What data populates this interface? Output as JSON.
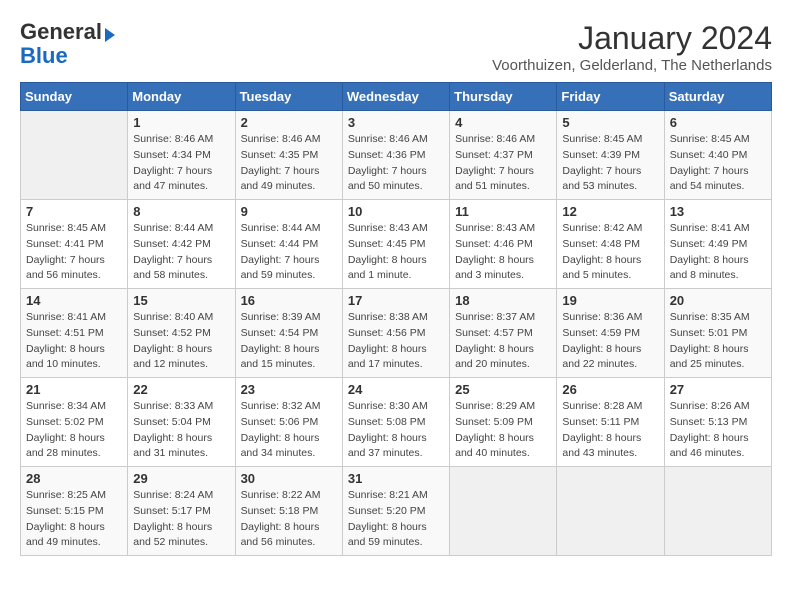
{
  "logo": {
    "general": "General",
    "blue": "Blue"
  },
  "title": "January 2024",
  "subtitle": "Voorthuizen, Gelderland, The Netherlands",
  "weekdays": [
    "Sunday",
    "Monday",
    "Tuesday",
    "Wednesday",
    "Thursday",
    "Friday",
    "Saturday"
  ],
  "weeks": [
    [
      {
        "day": "",
        "sunrise": "",
        "sunset": "",
        "daylight": ""
      },
      {
        "day": "1",
        "sunrise": "Sunrise: 8:46 AM",
        "sunset": "Sunset: 4:34 PM",
        "daylight": "Daylight: 7 hours and 47 minutes."
      },
      {
        "day": "2",
        "sunrise": "Sunrise: 8:46 AM",
        "sunset": "Sunset: 4:35 PM",
        "daylight": "Daylight: 7 hours and 49 minutes."
      },
      {
        "day": "3",
        "sunrise": "Sunrise: 8:46 AM",
        "sunset": "Sunset: 4:36 PM",
        "daylight": "Daylight: 7 hours and 50 minutes."
      },
      {
        "day": "4",
        "sunrise": "Sunrise: 8:46 AM",
        "sunset": "Sunset: 4:37 PM",
        "daylight": "Daylight: 7 hours and 51 minutes."
      },
      {
        "day": "5",
        "sunrise": "Sunrise: 8:45 AM",
        "sunset": "Sunset: 4:39 PM",
        "daylight": "Daylight: 7 hours and 53 minutes."
      },
      {
        "day": "6",
        "sunrise": "Sunrise: 8:45 AM",
        "sunset": "Sunset: 4:40 PM",
        "daylight": "Daylight: 7 hours and 54 minutes."
      }
    ],
    [
      {
        "day": "7",
        "sunrise": "Sunrise: 8:45 AM",
        "sunset": "Sunset: 4:41 PM",
        "daylight": "Daylight: 7 hours and 56 minutes."
      },
      {
        "day": "8",
        "sunrise": "Sunrise: 8:44 AM",
        "sunset": "Sunset: 4:42 PM",
        "daylight": "Daylight: 7 hours and 58 minutes."
      },
      {
        "day": "9",
        "sunrise": "Sunrise: 8:44 AM",
        "sunset": "Sunset: 4:44 PM",
        "daylight": "Daylight: 7 hours and 59 minutes."
      },
      {
        "day": "10",
        "sunrise": "Sunrise: 8:43 AM",
        "sunset": "Sunset: 4:45 PM",
        "daylight": "Daylight: 8 hours and 1 minute."
      },
      {
        "day": "11",
        "sunrise": "Sunrise: 8:43 AM",
        "sunset": "Sunset: 4:46 PM",
        "daylight": "Daylight: 8 hours and 3 minutes."
      },
      {
        "day": "12",
        "sunrise": "Sunrise: 8:42 AM",
        "sunset": "Sunset: 4:48 PM",
        "daylight": "Daylight: 8 hours and 5 minutes."
      },
      {
        "day": "13",
        "sunrise": "Sunrise: 8:41 AM",
        "sunset": "Sunset: 4:49 PM",
        "daylight": "Daylight: 8 hours and 8 minutes."
      }
    ],
    [
      {
        "day": "14",
        "sunrise": "Sunrise: 8:41 AM",
        "sunset": "Sunset: 4:51 PM",
        "daylight": "Daylight: 8 hours and 10 minutes."
      },
      {
        "day": "15",
        "sunrise": "Sunrise: 8:40 AM",
        "sunset": "Sunset: 4:52 PM",
        "daylight": "Daylight: 8 hours and 12 minutes."
      },
      {
        "day": "16",
        "sunrise": "Sunrise: 8:39 AM",
        "sunset": "Sunset: 4:54 PM",
        "daylight": "Daylight: 8 hours and 15 minutes."
      },
      {
        "day": "17",
        "sunrise": "Sunrise: 8:38 AM",
        "sunset": "Sunset: 4:56 PM",
        "daylight": "Daylight: 8 hours and 17 minutes."
      },
      {
        "day": "18",
        "sunrise": "Sunrise: 8:37 AM",
        "sunset": "Sunset: 4:57 PM",
        "daylight": "Daylight: 8 hours and 20 minutes."
      },
      {
        "day": "19",
        "sunrise": "Sunrise: 8:36 AM",
        "sunset": "Sunset: 4:59 PM",
        "daylight": "Daylight: 8 hours and 22 minutes."
      },
      {
        "day": "20",
        "sunrise": "Sunrise: 8:35 AM",
        "sunset": "Sunset: 5:01 PM",
        "daylight": "Daylight: 8 hours and 25 minutes."
      }
    ],
    [
      {
        "day": "21",
        "sunrise": "Sunrise: 8:34 AM",
        "sunset": "Sunset: 5:02 PM",
        "daylight": "Daylight: 8 hours and 28 minutes."
      },
      {
        "day": "22",
        "sunrise": "Sunrise: 8:33 AM",
        "sunset": "Sunset: 5:04 PM",
        "daylight": "Daylight: 8 hours and 31 minutes."
      },
      {
        "day": "23",
        "sunrise": "Sunrise: 8:32 AM",
        "sunset": "Sunset: 5:06 PM",
        "daylight": "Daylight: 8 hours and 34 minutes."
      },
      {
        "day": "24",
        "sunrise": "Sunrise: 8:30 AM",
        "sunset": "Sunset: 5:08 PM",
        "daylight": "Daylight: 8 hours and 37 minutes."
      },
      {
        "day": "25",
        "sunrise": "Sunrise: 8:29 AM",
        "sunset": "Sunset: 5:09 PM",
        "daylight": "Daylight: 8 hours and 40 minutes."
      },
      {
        "day": "26",
        "sunrise": "Sunrise: 8:28 AM",
        "sunset": "Sunset: 5:11 PM",
        "daylight": "Daylight: 8 hours and 43 minutes."
      },
      {
        "day": "27",
        "sunrise": "Sunrise: 8:26 AM",
        "sunset": "Sunset: 5:13 PM",
        "daylight": "Daylight: 8 hours and 46 minutes."
      }
    ],
    [
      {
        "day": "28",
        "sunrise": "Sunrise: 8:25 AM",
        "sunset": "Sunset: 5:15 PM",
        "daylight": "Daylight: 8 hours and 49 minutes."
      },
      {
        "day": "29",
        "sunrise": "Sunrise: 8:24 AM",
        "sunset": "Sunset: 5:17 PM",
        "daylight": "Daylight: 8 hours and 52 minutes."
      },
      {
        "day": "30",
        "sunrise": "Sunrise: 8:22 AM",
        "sunset": "Sunset: 5:18 PM",
        "daylight": "Daylight: 8 hours and 56 minutes."
      },
      {
        "day": "31",
        "sunrise": "Sunrise: 8:21 AM",
        "sunset": "Sunset: 5:20 PM",
        "daylight": "Daylight: 8 hours and 59 minutes."
      },
      {
        "day": "",
        "sunrise": "",
        "sunset": "",
        "daylight": ""
      },
      {
        "day": "",
        "sunrise": "",
        "sunset": "",
        "daylight": ""
      },
      {
        "day": "",
        "sunrise": "",
        "sunset": "",
        "daylight": ""
      }
    ]
  ]
}
